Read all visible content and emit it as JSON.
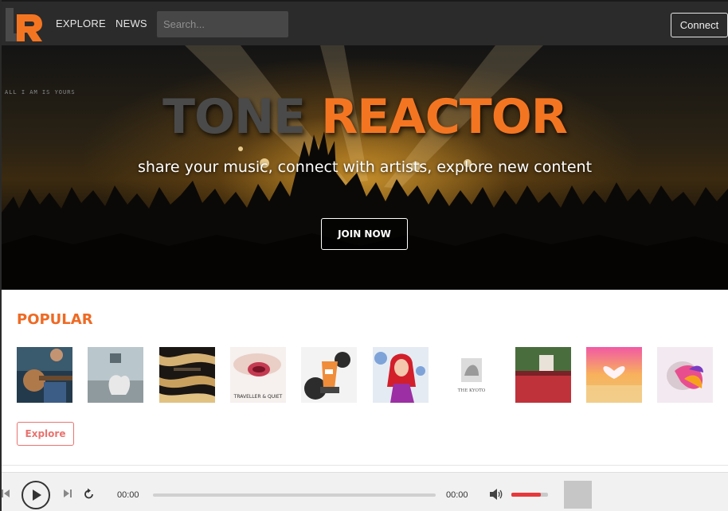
{
  "app": {
    "logo_letters": "TR",
    "colors": {
      "accent": "#f47521",
      "navbar": "#2b2b2b",
      "explore_button": "#e8736f",
      "volume": "#e8373a"
    }
  },
  "nav": {
    "links": [
      "EXPLORE",
      "NEWS"
    ],
    "search_placeholder": "Search...",
    "connect_label": "Connect"
  },
  "hero": {
    "banner_text": "ALL I AM IS YOURS",
    "title_part1": "TONE",
    "title_part2": "REACTOR",
    "subtitle": "share your music, connect with artists, explore new content",
    "join_label": "JOIN NOW"
  },
  "popular": {
    "heading": "POPULAR",
    "thumbnail_lettering": [
      "THE KYOTO",
      "TRAVELLER & QUIET"
    ],
    "explore_label": "Explore"
  },
  "player": {
    "current_time": "00:00",
    "duration": "00:00",
    "progress": 0,
    "volume": 0.8,
    "icons": [
      "skip-back-icon",
      "play-icon",
      "skip-forward-icon",
      "repeat-icon",
      "volume-icon"
    ]
  }
}
